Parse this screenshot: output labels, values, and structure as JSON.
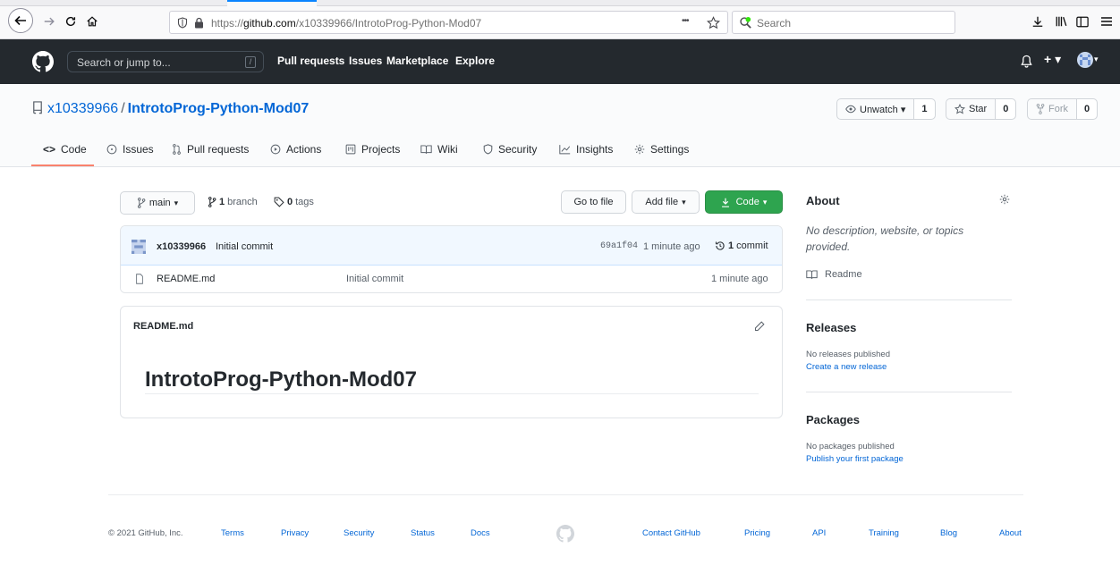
{
  "browser": {
    "url_prefix": "https://",
    "url_host": "github.com",
    "url_path": "/x10339966/IntrotoProg-Python-Mod07",
    "more_glyph": "•••",
    "search_placeholder": "Search"
  },
  "header": {
    "search_placeholder": "Search or jump to...",
    "slash_key": "/",
    "nav": [
      "Pull requests",
      "Issues",
      "Marketplace",
      "Explore"
    ],
    "plus_label": "+ ▾"
  },
  "repo": {
    "owner": "x10339966",
    "separator": "/",
    "name": "IntrotoProg-Python-Mod07",
    "watch": {
      "label": "Unwatch ▾",
      "count": "1"
    },
    "star": {
      "label": "Star",
      "count": "0"
    },
    "fork": {
      "label": "Fork",
      "count": "0"
    },
    "tabs": [
      {
        "label": "Code",
        "icon": "code-icon"
      },
      {
        "label": "Issues",
        "icon": "issue-icon"
      },
      {
        "label": "Pull requests",
        "icon": "pull-request-icon"
      },
      {
        "label": "Actions",
        "icon": "play-icon"
      },
      {
        "label": "Projects",
        "icon": "project-icon"
      },
      {
        "label": "Wiki",
        "icon": "book-icon"
      },
      {
        "label": "Security",
        "icon": "shield-icon"
      },
      {
        "label": "Insights",
        "icon": "graph-icon"
      },
      {
        "label": "Settings",
        "icon": "gear-icon"
      }
    ]
  },
  "toolbar": {
    "branch": "main",
    "branch_count": "1",
    "branch_word": "branch",
    "tag_count": "0",
    "tag_word": "tags",
    "go_to_file": "Go to file",
    "add_file": "Add file",
    "code": "Code"
  },
  "commit": {
    "author": "x10339966",
    "message": "Initial commit",
    "sha": "69a1f04",
    "time": "1 minute ago",
    "count": "1",
    "count_word": "commit"
  },
  "files": [
    {
      "name": "README.md",
      "message": "Initial commit",
      "time": "1 minute ago"
    }
  ],
  "readme": {
    "filename": "README.md",
    "title": "IntrotoProg-Python-Mod07"
  },
  "about": {
    "heading": "About",
    "description": "No description, website, or topics provided.",
    "readme_link": "Readme"
  },
  "releases": {
    "heading": "Releases",
    "empty": "No releases published",
    "create_link": "Create a new release"
  },
  "packages": {
    "heading": "Packages",
    "empty": "No packages published",
    "publish_link": "Publish your first package"
  },
  "footer": {
    "copyright": "© 2021 GitHub, Inc.",
    "left_links": [
      "Terms",
      "Privacy",
      "Security",
      "Status",
      "Docs"
    ],
    "right_links": [
      "Contact GitHub",
      "Pricing",
      "API",
      "Training",
      "Blog",
      "About"
    ]
  },
  "colors": {
    "header_bg": "#24292e",
    "link": "#0366d6",
    "code_button": "#2ea44f",
    "tab_underline": "#f9826c",
    "commit_bg": "#f1f8ff"
  }
}
